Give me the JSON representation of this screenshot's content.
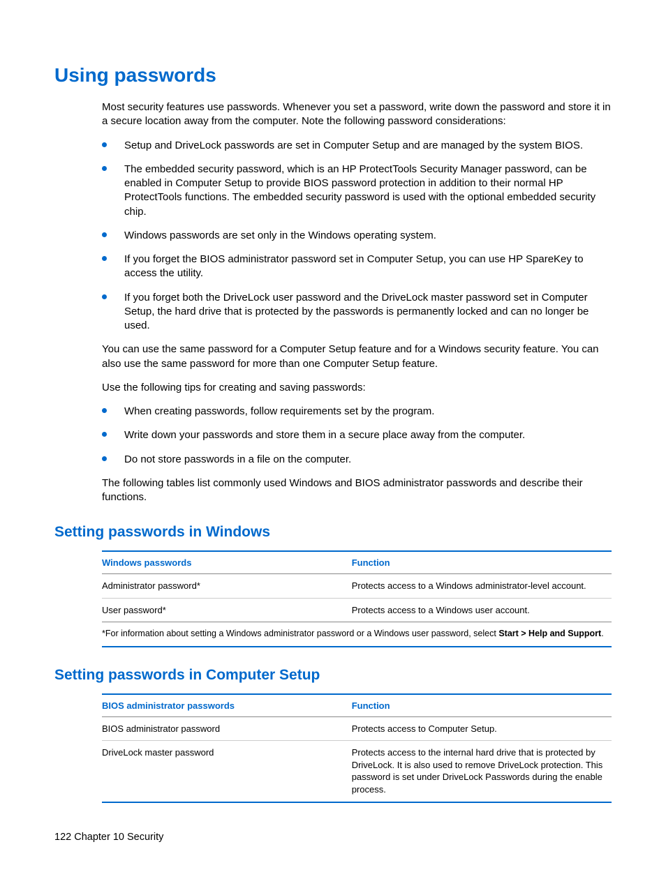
{
  "h1": "Using passwords",
  "intro": "Most security features use passwords. Whenever you set a password, write down the password and store it in a secure location away from the computer. Note the following password considerations:",
  "bullets1": [
    "Setup and DriveLock passwords are set in Computer Setup and are managed by the system BIOS.",
    "The embedded security password, which is an HP ProtectTools Security Manager password, can be enabled in Computer Setup to provide BIOS password protection in addition to their normal HP ProtectTools functions. The embedded security password is used with the optional embedded security chip.",
    "Windows passwords are set only in the Windows operating system.",
    "If you forget the BIOS administrator password set in Computer Setup, you can use HP SpareKey to access the utility.",
    "If you forget both the DriveLock user password and the DriveLock master password set in Computer Setup, the hard drive that is protected by the passwords is permanently locked and can no longer be used."
  ],
  "para2": "You can use the same password for a Computer Setup feature and for a Windows security feature. You can also use the same password for more than one Computer Setup feature.",
  "para3": "Use the following tips for creating and saving passwords:",
  "bullets2": [
    "When creating passwords, follow requirements set by the program.",
    "Write down your passwords and store them in a secure place away from the computer.",
    "Do not store passwords in a file on the computer."
  ],
  "para4": "The following tables list commonly used Windows and BIOS administrator passwords and describe their functions.",
  "h2a": "Setting passwords in Windows",
  "table1": {
    "head": [
      "Windows passwords",
      "Function"
    ],
    "rows": [
      [
        "Administrator password*",
        "Protects access to a Windows administrator-level account."
      ],
      [
        "User password*",
        "Protects access to a Windows user account."
      ]
    ],
    "foot_pre": "*For information about setting a Windows administrator password or a Windows user password, select ",
    "foot_bold": "Start > Help and Support",
    "foot_post": "."
  },
  "h2b": "Setting passwords in Computer Setup",
  "table2": {
    "head": [
      "BIOS administrator passwords",
      "Function"
    ],
    "rows": [
      [
        "BIOS administrator password",
        "Protects access to Computer Setup."
      ],
      [
        "DriveLock master password",
        "Protects access to the internal hard drive that is protected by DriveLock. It is also used to remove DriveLock protection. This password is set under DriveLock Passwords during the enable process."
      ]
    ]
  },
  "footer": "122   Chapter 10   Security"
}
